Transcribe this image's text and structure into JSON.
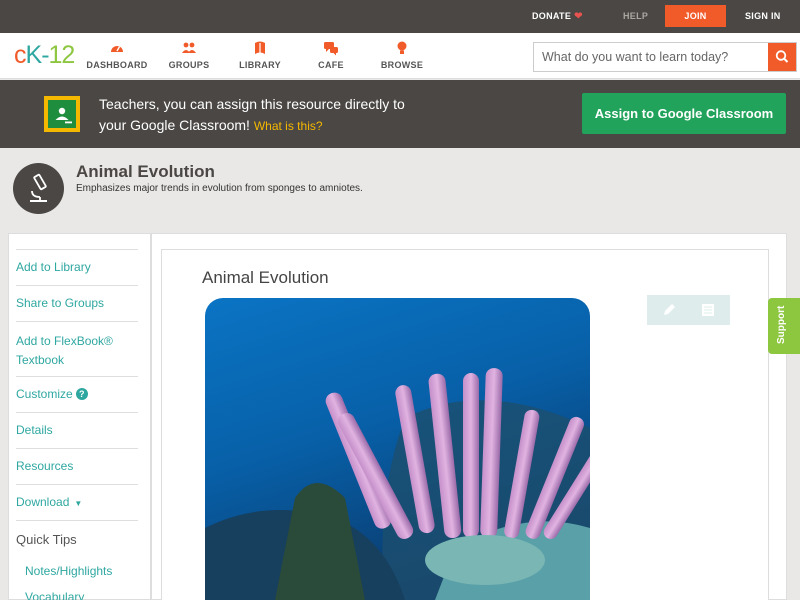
{
  "topbar": {
    "donate": "DONATE",
    "help": "HELP",
    "join": "JOIN",
    "signin": "SIGN IN"
  },
  "nav": {
    "logo": {
      "c": "c",
      "k": "K",
      "dash": "-",
      "num": "12"
    },
    "items": [
      {
        "label": "DASHBOARD",
        "icon": "dashboard-icon"
      },
      {
        "label": "GROUPS",
        "icon": "groups-icon"
      },
      {
        "label": "LIBRARY",
        "icon": "library-icon"
      },
      {
        "label": "CAFE",
        "icon": "cafe-icon"
      },
      {
        "label": "BROWSE",
        "icon": "browse-icon"
      }
    ],
    "search_placeholder": "What do you want to learn today?"
  },
  "banner": {
    "line1": "Teachers, you can assign this resource directly to",
    "line2": "your Google Classroom!",
    "what": "What is this?",
    "button": "Assign to Google Classroom"
  },
  "header": {
    "title": "Animal Evolution",
    "subtitle": "Emphasizes major trends in evolution from sponges to amniotes."
  },
  "sidebar": {
    "items": [
      "Add to Library",
      "Share to Groups",
      "Add to FlexBook® Textbook",
      "Customize",
      "Details",
      "Resources",
      "Download"
    ],
    "customize_badge": "?",
    "quick_tips": "Quick Tips",
    "sub_items": [
      "Notes/Highlights",
      "Vocabulary"
    ]
  },
  "main": {
    "title": "Animal Evolution"
  },
  "support": "Support",
  "colors": {
    "accent_orange": "#f15a29",
    "teal": "#2fa7a1",
    "green": "#21a35b",
    "support_green": "#8dc63f",
    "dark": "#4a4744"
  }
}
